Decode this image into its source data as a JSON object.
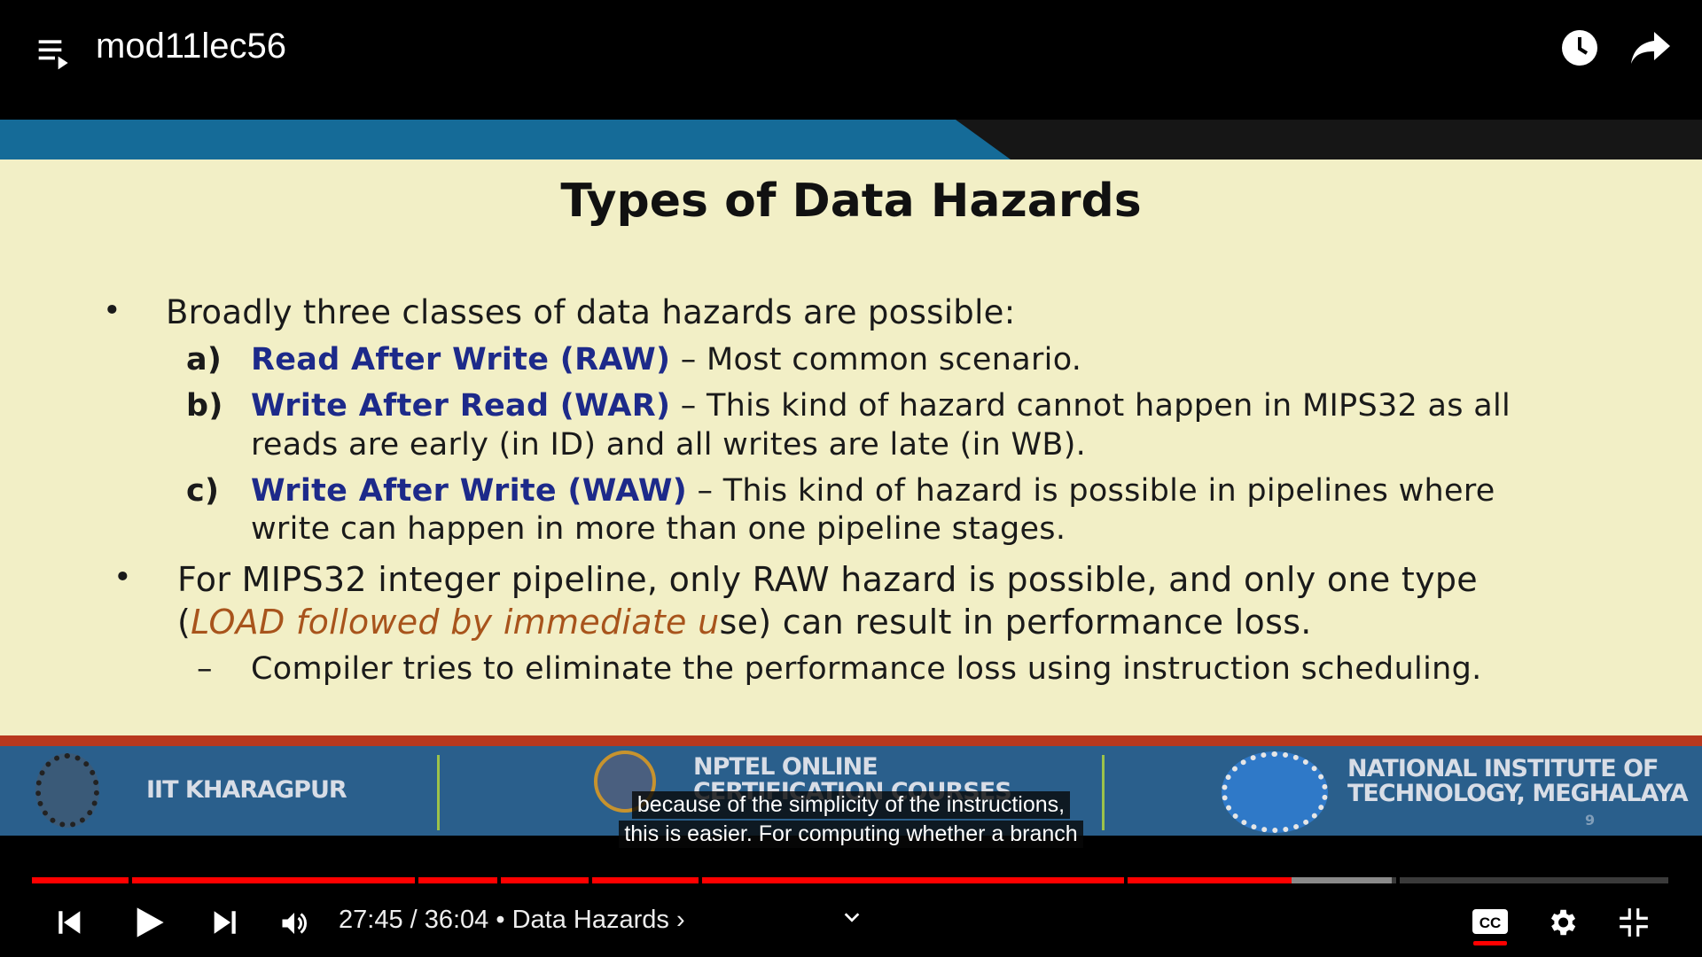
{
  "header": {
    "title": "mod11lec56",
    "icons": [
      "playlist-icon",
      "watch-later-icon",
      "share-icon"
    ]
  },
  "slide": {
    "title": "Types of Data Hazards",
    "bullet1": "Broadly three classes of data hazards are possible:",
    "items": [
      {
        "label": "a)",
        "name": "Read After Write (RAW)",
        "text": " – Most common scenario.",
        "cont": ""
      },
      {
        "label": "b)",
        "name": "Write After Read (WAR)",
        "text": " – This kind of hazard cannot happen in MIPS32 as all",
        "cont": "reads are early (in ID) and all writes are late (in WB)."
      },
      {
        "label": "c)",
        "name": "Write After Write (WAW)",
        "text": " – This kind of hazard is possible in pipelines where",
        "cont": "write can happen in more than one pipeline stages."
      }
    ],
    "bullet2_line1": "For MIPS32 integer pipeline, only RAW hazard is possible, and only one type",
    "bullet2_open": "(",
    "bullet2_italic": "LOAD followed by immediate u",
    "bullet2_rest": "se) can result in performance loss.",
    "sub_dash": "–",
    "sub": "Compiler tries to eliminate the performance loss using instruction scheduling.",
    "footer": {
      "left": "IIT KHARAGPUR",
      "center_line1": "NPTEL ONLINE",
      "center_line2": "CERTIFICATION COURSES",
      "right_line1": "NATIONAL INSTITUTE OF",
      "right_line2": "TECHNOLOGY, MEGHALAYA",
      "page": "9"
    },
    "colors": {
      "blue_band": "#156b98",
      "background": "#f2efc6",
      "term": "#1d2a8a",
      "highlight": "#a8541c",
      "footer": "#2a5f8c"
    }
  },
  "captions": [
    "because of the simplicity of the instructions,",
    "this is easier. For computing whether a branch"
  ],
  "player": {
    "current_time": "27:45",
    "duration": "36:04",
    "time_display": "27:45 / 36:04",
    "chapter": "• Data Hazards ›",
    "progress_fraction": 0.769,
    "buffered_fraction": 0.83,
    "accent": "#ff0000",
    "captions_on": true
  }
}
